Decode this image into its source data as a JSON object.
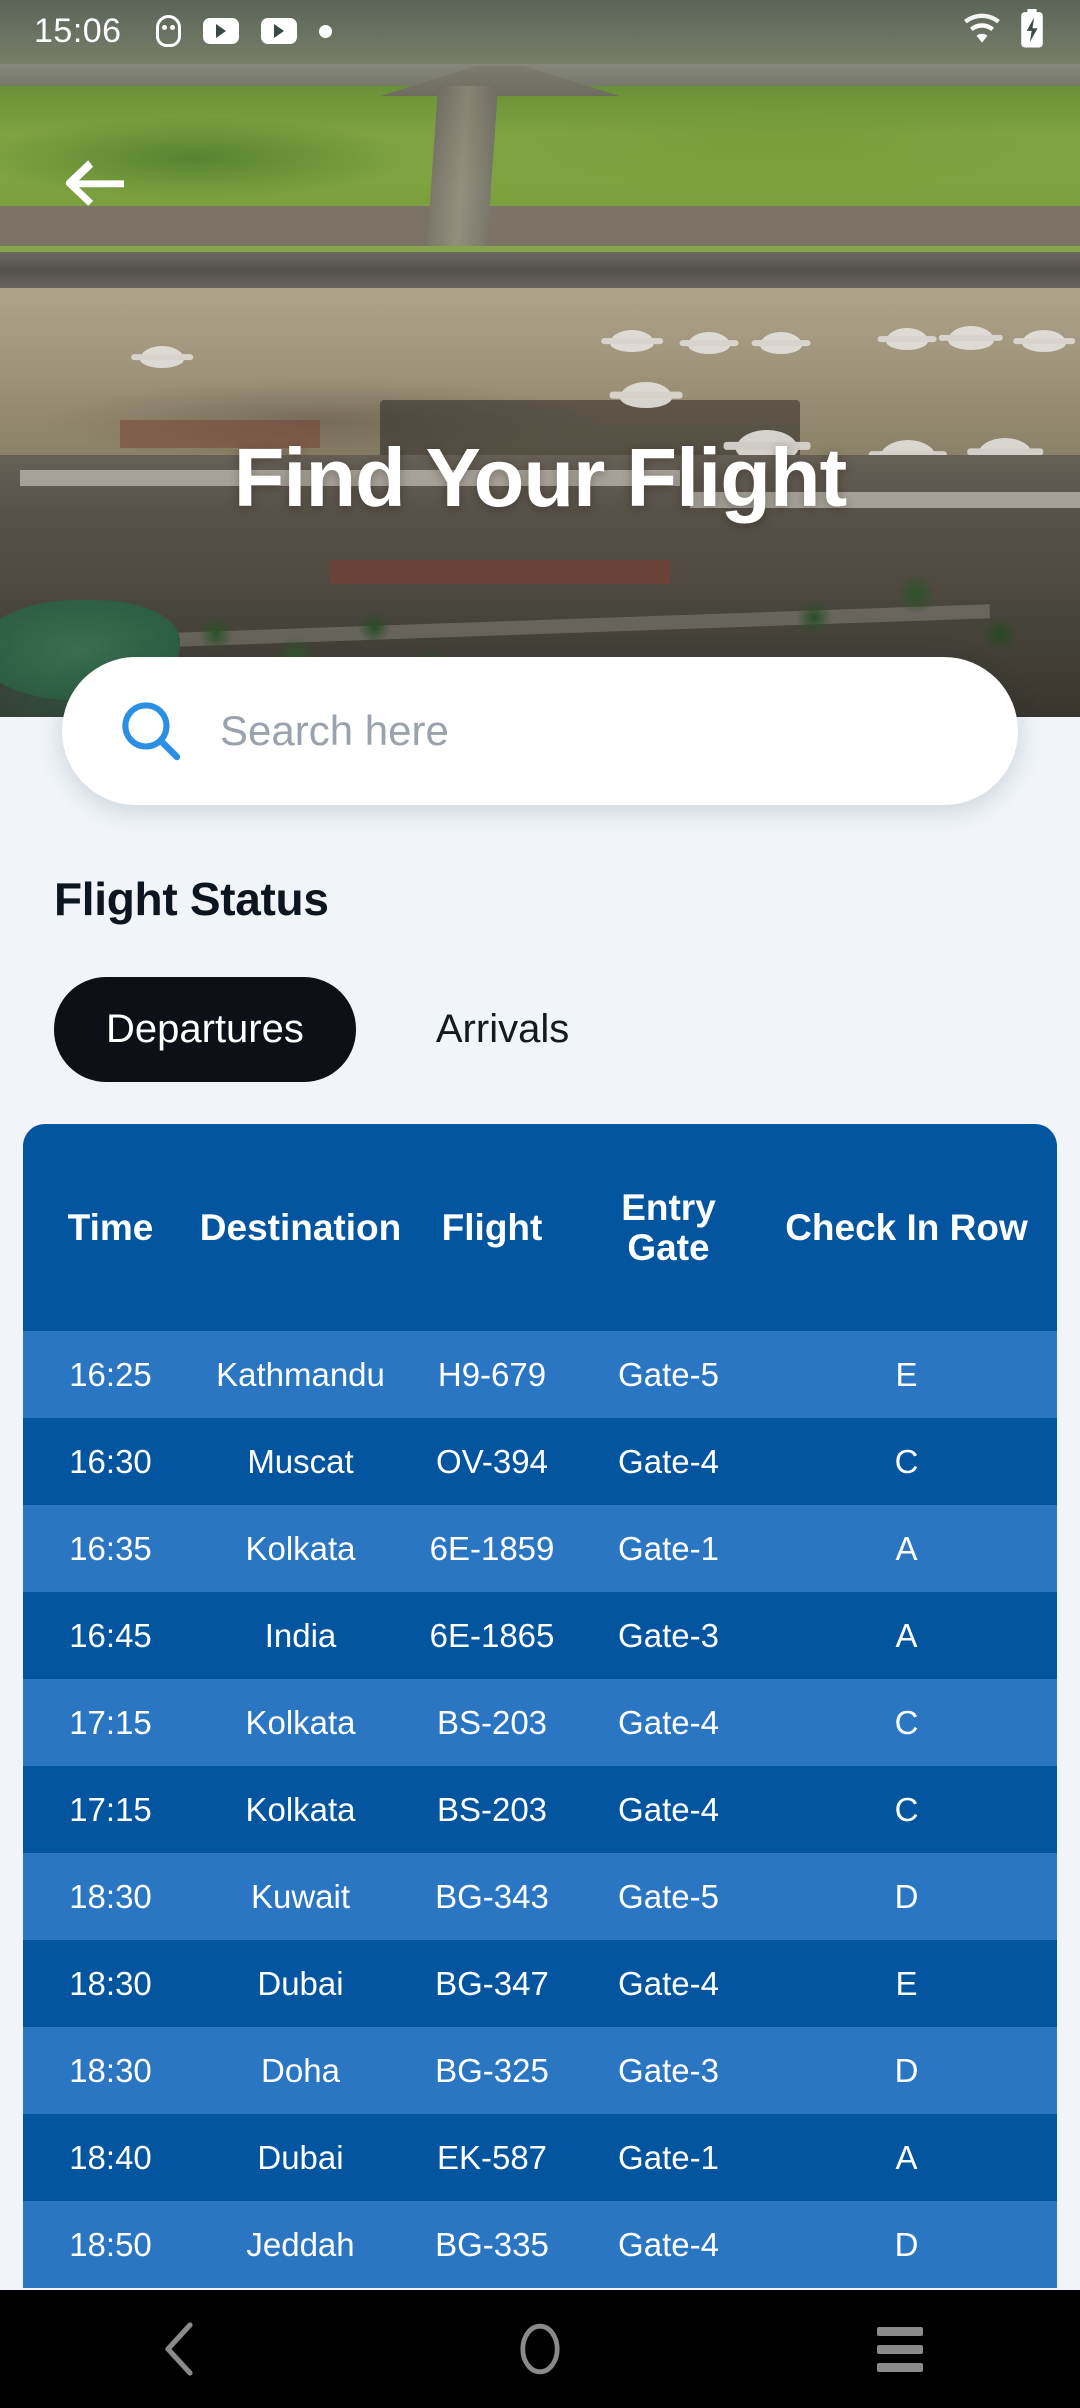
{
  "status_bar": {
    "time": "15:06",
    "left_icons": [
      "face-icon",
      "youtube-icon",
      "youtube-icon",
      "dot-icon"
    ],
    "right_icons": [
      "wifi-icon",
      "battery-charging-icon"
    ]
  },
  "hero": {
    "back_icon": "back-arrow-icon",
    "title": "Find Your Flight"
  },
  "search": {
    "icon": "search-icon",
    "placeholder": "Search here",
    "value": ""
  },
  "flight_status": {
    "heading": "Flight Status",
    "tabs": [
      {
        "label": "Departures",
        "active": true
      },
      {
        "label": "Arrivals",
        "active": false
      }
    ]
  },
  "table": {
    "headers": {
      "time": "Time",
      "destination": "Destination",
      "flight": "Flight",
      "entry_gate_line1": "Entry",
      "entry_gate_line2": "Gate",
      "check_in_row": "Check In Row"
    },
    "rows": [
      {
        "time": "16:25",
        "destination": "Kathmandu",
        "flight": "H9-679",
        "gate": "Gate-5",
        "row": "E"
      },
      {
        "time": "16:30",
        "destination": "Muscat",
        "flight": "OV-394",
        "gate": "Gate-4",
        "row": "C"
      },
      {
        "time": "16:35",
        "destination": "Kolkata",
        "flight": "6E-1859",
        "gate": "Gate-1",
        "row": "A"
      },
      {
        "time": "16:45",
        "destination": "India",
        "flight": "6E-1865",
        "gate": "Gate-3",
        "row": "A"
      },
      {
        "time": "17:15",
        "destination": "Kolkata",
        "flight": "BS-203",
        "gate": "Gate-4",
        "row": "C"
      },
      {
        "time": "17:15",
        "destination": "Kolkata",
        "flight": "BS-203",
        "gate": "Gate-4",
        "row": "C"
      },
      {
        "time": "18:30",
        "destination": "Kuwait",
        "flight": "BG-343",
        "gate": "Gate-5",
        "row": "D"
      },
      {
        "time": "18:30",
        "destination": "Dubai",
        "flight": "BG-347",
        "gate": "Gate-4",
        "row": "E"
      },
      {
        "time": "18:30",
        "destination": "Doha",
        "flight": "BG-325",
        "gate": "Gate-3",
        "row": "D"
      },
      {
        "time": "18:40",
        "destination": "Dubai",
        "flight": "EK-587",
        "gate": "Gate-1",
        "row": "A"
      },
      {
        "time": "18:50",
        "destination": "Jeddah",
        "flight": "BG-335",
        "gate": "Gate-4",
        "row": "D"
      }
    ]
  },
  "nav_bar": {
    "back_icon": "nav-back-icon",
    "home_icon": "nav-home-icon",
    "recents_icon": "nav-recents-icon"
  },
  "colors": {
    "page_background": "#F1F5F9",
    "table_header": "#03559F",
    "row_light": "#2A76C2",
    "row_dark": "#03559F",
    "tab_active": "#0D1117",
    "search_icon": "#2B8FE3",
    "placeholder": "#9AA2AD",
    "nav_bar": "#000000"
  }
}
